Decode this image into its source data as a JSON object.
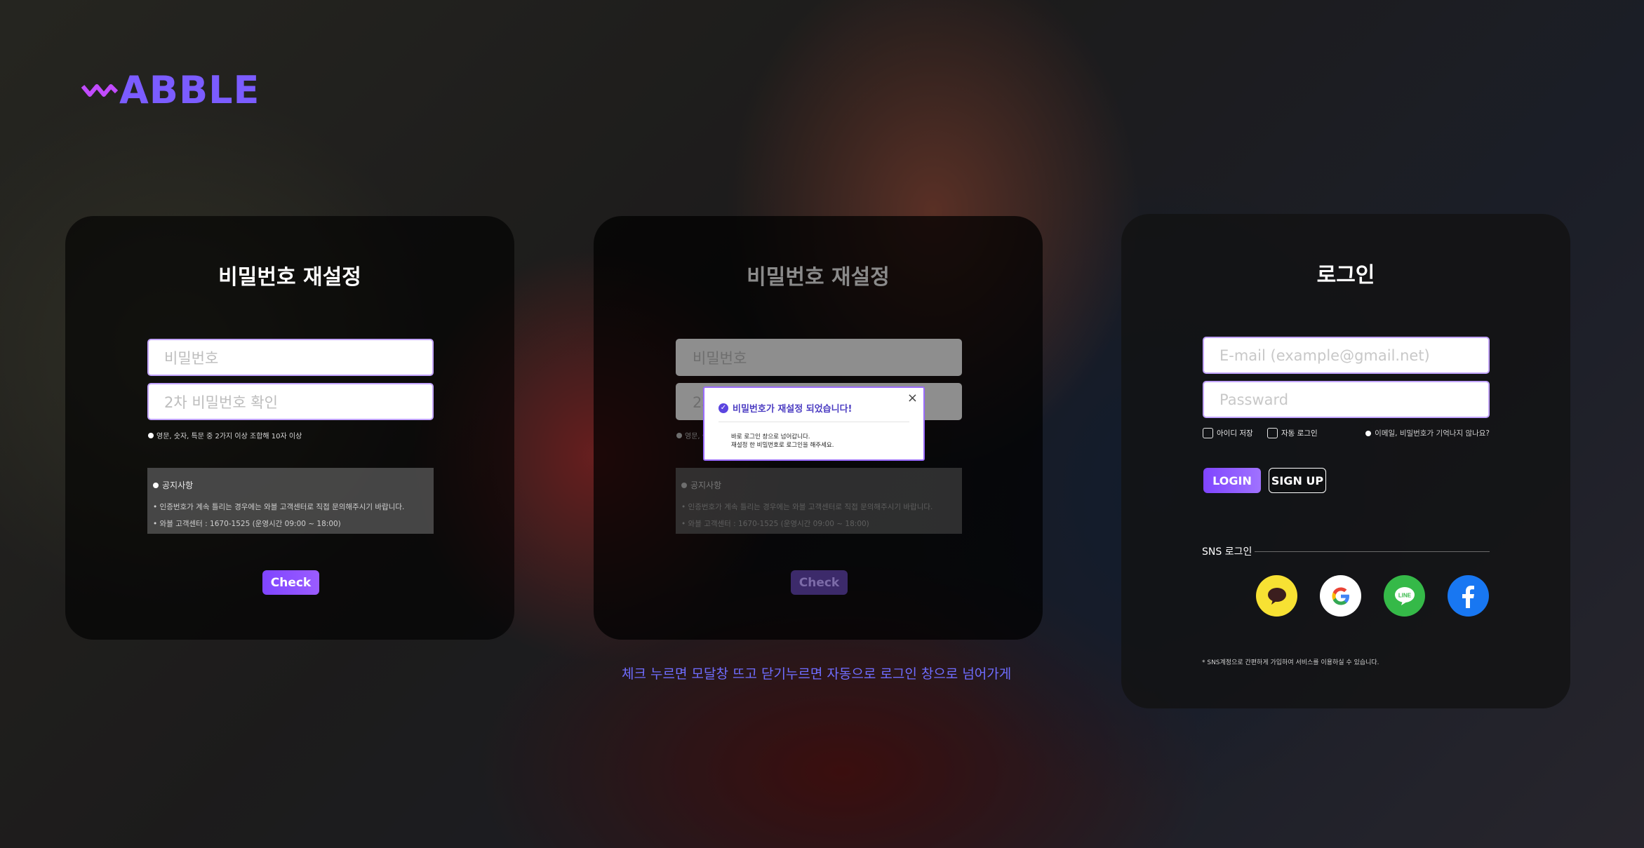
{
  "brand": {
    "name": "ABBLE",
    "color": "#7b5cff"
  },
  "reset_panel": {
    "title": "비밀번호 재설정",
    "password_placeholder": "비밀번호",
    "confirm_placeholder": "2차 비밀번호 확인",
    "hint": "영문, 숫자, 특문 중 2가지 이상 조합해 10자 이상",
    "notice_title": "공지사항",
    "notice_lines": [
      "• 인증번호가 계속 틀리는 경우에는 와블 고객센터로 직접 문의해주시기 바랍니다.",
      "• 와블 고객센터 : 1670-1525 (운영시간 09:00 ~ 18:00)"
    ],
    "check_label": "Check"
  },
  "modal": {
    "title": "비밀번호가 재설정 되었습니다!",
    "close": "×",
    "body_lines": [
      "바로 로그인 창으로 넘어갑니다.",
      "재설정 한 비밀번호로 로그인을 해주세요."
    ]
  },
  "caption": "체크 누르면 모달창 뜨고 닫기누르면 자동으로 로그인 창으로 넘어가게",
  "login_panel": {
    "title": "로그인",
    "email_placeholder": "E-mail (example@gmail.net)",
    "password_placeholder": "Passward",
    "save_id": "아이디 저장",
    "auto_login": "자동 로그인",
    "forgot": "이메일, 비밀번호가 기억나지 않나요?",
    "login_label": "LOGIN",
    "signup_label": "SIGN UP",
    "sns_label": "SNS 로그인",
    "sns_icons": [
      "kakao-icon",
      "google-icon",
      "line-icon",
      "facebook-icon"
    ],
    "sns_note": "* SNS계정으로 간편하게 가입하여 서비스를 이용하실 수 있습니다."
  },
  "colors": {
    "accent": "#7f45ff",
    "caption": "#6f6dff",
    "kakao": "#f7e133",
    "line": "#35b948",
    "facebook": "#1877f2"
  }
}
